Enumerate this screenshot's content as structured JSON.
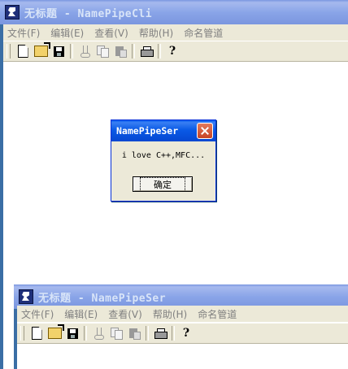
{
  "client_window": {
    "title_prefix": "无标题",
    "title_suffix": " - NamePipeCli",
    "menu": [
      "文件(F)",
      "编辑(E)",
      "查看(V)",
      "帮助(H)",
      "命名管道"
    ]
  },
  "server_window": {
    "title_prefix": "无标题",
    "title_suffix": " - NamePipeSer",
    "menu": [
      "文件(F)",
      "编辑(E)",
      "查看(V)",
      "帮助(H)",
      "命名管道"
    ]
  },
  "toolbar_icons": [
    "new-icon",
    "open-icon",
    "save-icon",
    "cut-icon",
    "copy-icon",
    "paste-icon",
    "print-icon",
    "help-icon"
  ],
  "dialog": {
    "title": "NamePipeSer",
    "message": "i love C++,MFC...",
    "ok_label": "确定"
  }
}
